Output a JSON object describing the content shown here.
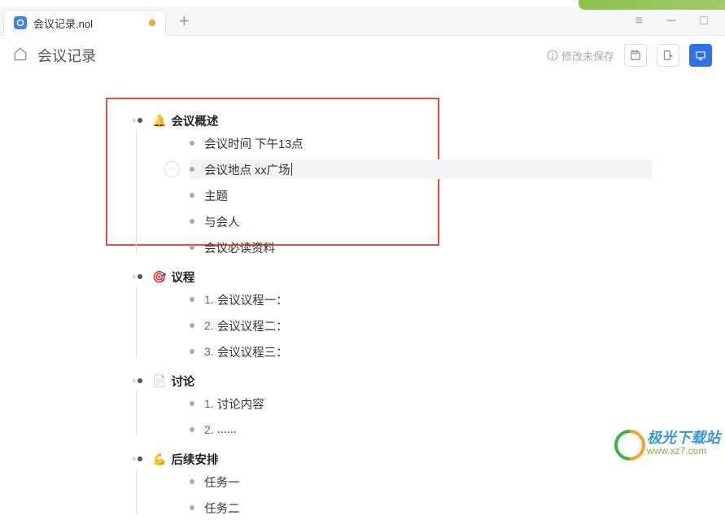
{
  "tab": {
    "title": "会议记录.nol"
  },
  "toolbar": {
    "doc_title": "会议记录",
    "unsaved_label": "修改未保存"
  },
  "outline": [
    {
      "icon": "🔔",
      "text": "会议概述",
      "bold": true,
      "children": [
        {
          "text": "会议时间 下午13点"
        },
        {
          "text": "会议地点  xx广场",
          "selected": true,
          "cursor": true
        },
        {
          "text": "主题"
        },
        {
          "text": "与会人"
        },
        {
          "text": "会议必读资料"
        }
      ]
    },
    {
      "icon": "🎯",
      "text": "议程",
      "bold": true,
      "children": [
        {
          "num": "1.",
          "text": "会议议程一："
        },
        {
          "num": "2.",
          "text": "会议议程二："
        },
        {
          "num": "3.",
          "text": "会议议程三："
        }
      ]
    },
    {
      "icon": "📄",
      "text": "讨论",
      "bold": true,
      "children": [
        {
          "num": "1.",
          "text": "讨论内容"
        },
        {
          "num": "2.",
          "text": "......"
        }
      ]
    },
    {
      "icon": "💪",
      "text": "后续安排",
      "bold": true,
      "children": [
        {
          "text": "任务一"
        },
        {
          "text": "任务二"
        }
      ]
    }
  ],
  "watermark": {
    "name": "极光下载站",
    "url": "www.xz7.com"
  }
}
